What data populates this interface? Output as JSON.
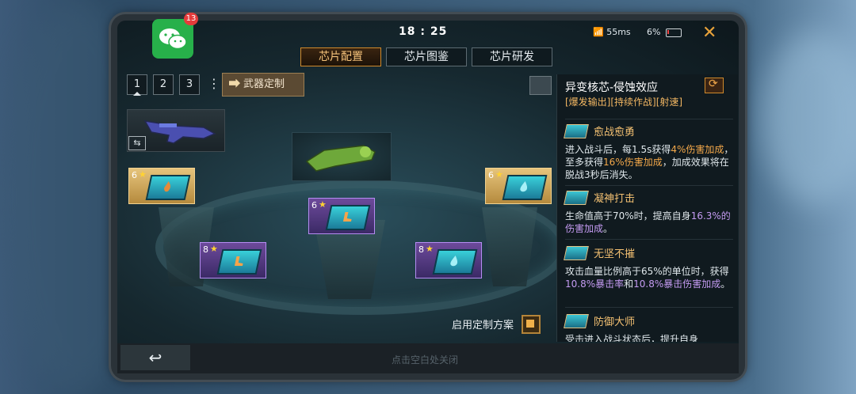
{
  "status": {
    "time": "18 : 25",
    "network": "55ms",
    "battery": "6%",
    "wechat_badge": "13"
  },
  "tabs": [
    {
      "label": "芯片配置",
      "active": true
    },
    {
      "label": "芯片图鉴",
      "active": false
    },
    {
      "label": "芯片研发",
      "active": false
    }
  ],
  "presets": [
    "1",
    "2",
    "3"
  ],
  "more_icon": "⋮",
  "weapon_button": "武器定制",
  "swap_icon": "⇆",
  "chips": [
    {
      "level": "6",
      "rarity": "gold",
      "symbol": "flame"
    },
    {
      "level": "6",
      "rarity": "purple",
      "symbol": "boot"
    },
    {
      "level": "6",
      "rarity": "gold",
      "symbol": "drop"
    },
    {
      "level": "8",
      "rarity": "purple",
      "symbol": "boot"
    },
    {
      "level": "8",
      "rarity": "purple",
      "symbol": "drop"
    }
  ],
  "use_plan_label": "启用定制方案",
  "back_icon": "↩",
  "close_hint": "点击空白处关闭",
  "panel": {
    "title": "异变核芯-侵蚀效应",
    "tags": "[爆发输出][持续作战][射速]",
    "skills": [
      {
        "name": "愈战愈勇",
        "desc": [
          {
            "t": "进入战斗后，每1.5s获得",
            "c": ""
          },
          {
            "t": "4%伤害加成",
            "c": "o"
          },
          {
            "t": "，至多获得",
            "c": ""
          },
          {
            "t": "16%伤害加成",
            "c": "o"
          },
          {
            "t": "，加成效果将在脱战3秒后消失。",
            "c": ""
          }
        ]
      },
      {
        "name": "凝神打击",
        "desc": [
          {
            "t": "生命值高于70%时，提高自身",
            "c": ""
          },
          {
            "t": "16.3%的伤害加成",
            "c": "p"
          },
          {
            "t": "。",
            "c": ""
          }
        ]
      },
      {
        "name": "无坚不摧",
        "desc": [
          {
            "t": "攻击血量比例高于65%的单位时，获得",
            "c": ""
          },
          {
            "t": "10.8%暴击率",
            "c": "p"
          },
          {
            "t": "和",
            "c": ""
          },
          {
            "t": "10.8%暴击伤害加成",
            "c": "p"
          },
          {
            "t": "。",
            "c": ""
          }
        ]
      },
      {
        "name": "防御大师",
        "desc": [
          {
            "t": "受击进入战斗状态后，提升自身",
            "c": ""
          }
        ]
      }
    ]
  },
  "colors": {
    "accent": "#d08a2c",
    "gold_chip": "#e6c47c",
    "purple_chip": "#6d4a9b",
    "highlight_orange": "#f3a84a",
    "highlight_purple": "#c49bf2"
  }
}
